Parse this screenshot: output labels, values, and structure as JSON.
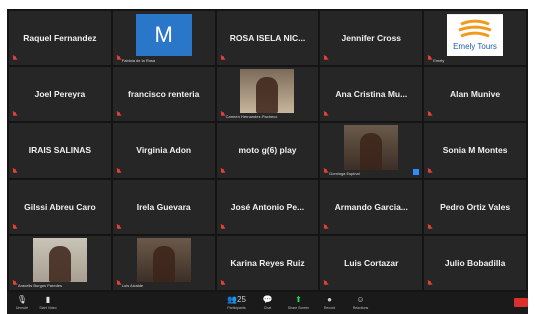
{
  "meeting": {
    "participants": [
      {
        "name": "Raquel Fernandez",
        "muted": true
      },
      {
        "name": "",
        "avatar_letter": "M",
        "tag": "Fabiola de la Rosa",
        "muted": true
      },
      {
        "name": "ROSA ISELA NIC...",
        "muted": true
      },
      {
        "name": "Jennifer Cross",
        "muted": true
      },
      {
        "name": "",
        "logo": "Emely Tours",
        "tag": "Emely",
        "muted": true
      },
      {
        "name": "Joel Pereyra",
        "muted": true
      },
      {
        "name": "francisco renteria",
        "muted": true
      },
      {
        "name": "",
        "video": true,
        "tag": "Carmen Hernandez-Pacheco",
        "muted": true
      },
      {
        "name": "Ana Cristina Mu...",
        "muted": true
      },
      {
        "name": "Alan Munive",
        "muted": true
      },
      {
        "name": "IRAIS SALINAS",
        "muted": true
      },
      {
        "name": "Virginia Adon",
        "muted": true
      },
      {
        "name": "moto g(6) play",
        "muted": true
      },
      {
        "name": "",
        "video": true,
        "tag": "Dominga Espinal",
        "muted": true
      },
      {
        "name": "Sonia M Montes",
        "muted": true
      },
      {
        "name": "Gilssi Abreu Caro",
        "muted": true
      },
      {
        "name": "Irela Guevara",
        "muted": true
      },
      {
        "name": "José Antonio Pe...",
        "muted": true
      },
      {
        "name": "Armando Garcia...",
        "muted": true
      },
      {
        "name": "Pedro Ortiz Vales",
        "muted": true
      },
      {
        "name": "",
        "video": true,
        "tag": "Aracelis Burgos Paredes",
        "muted": true
      },
      {
        "name": "",
        "video": true,
        "tag": "Luis Alcalde",
        "muted": true
      },
      {
        "name": "Karina Reyes Ruiz",
        "muted": true
      },
      {
        "name": "Luis Cortazar",
        "muted": true
      },
      {
        "name": "Julio Bobadilla",
        "muted": true
      }
    ]
  },
  "toolbar": {
    "left": [
      {
        "icon": "microphone-icon",
        "label": "Unmute"
      },
      {
        "icon": "video-camera-icon",
        "label": "Start Video"
      }
    ],
    "center": [
      {
        "icon": "participants-icon",
        "glyph": "👥",
        "count": "25",
        "label": "Participants"
      },
      {
        "icon": "chat-icon",
        "glyph": "💬",
        "label": "Chat"
      },
      {
        "icon": "share-screen-icon",
        "glyph": "⬆",
        "label": "Share Screen"
      },
      {
        "icon": "record-icon",
        "glyph": "●",
        "label": "Record"
      },
      {
        "icon": "reactions-icon",
        "glyph": "☺",
        "label": "Reactions"
      }
    ],
    "colors": {
      "share": "#23d959",
      "leave": "#d9302c",
      "mute": "#e0423a"
    }
  }
}
